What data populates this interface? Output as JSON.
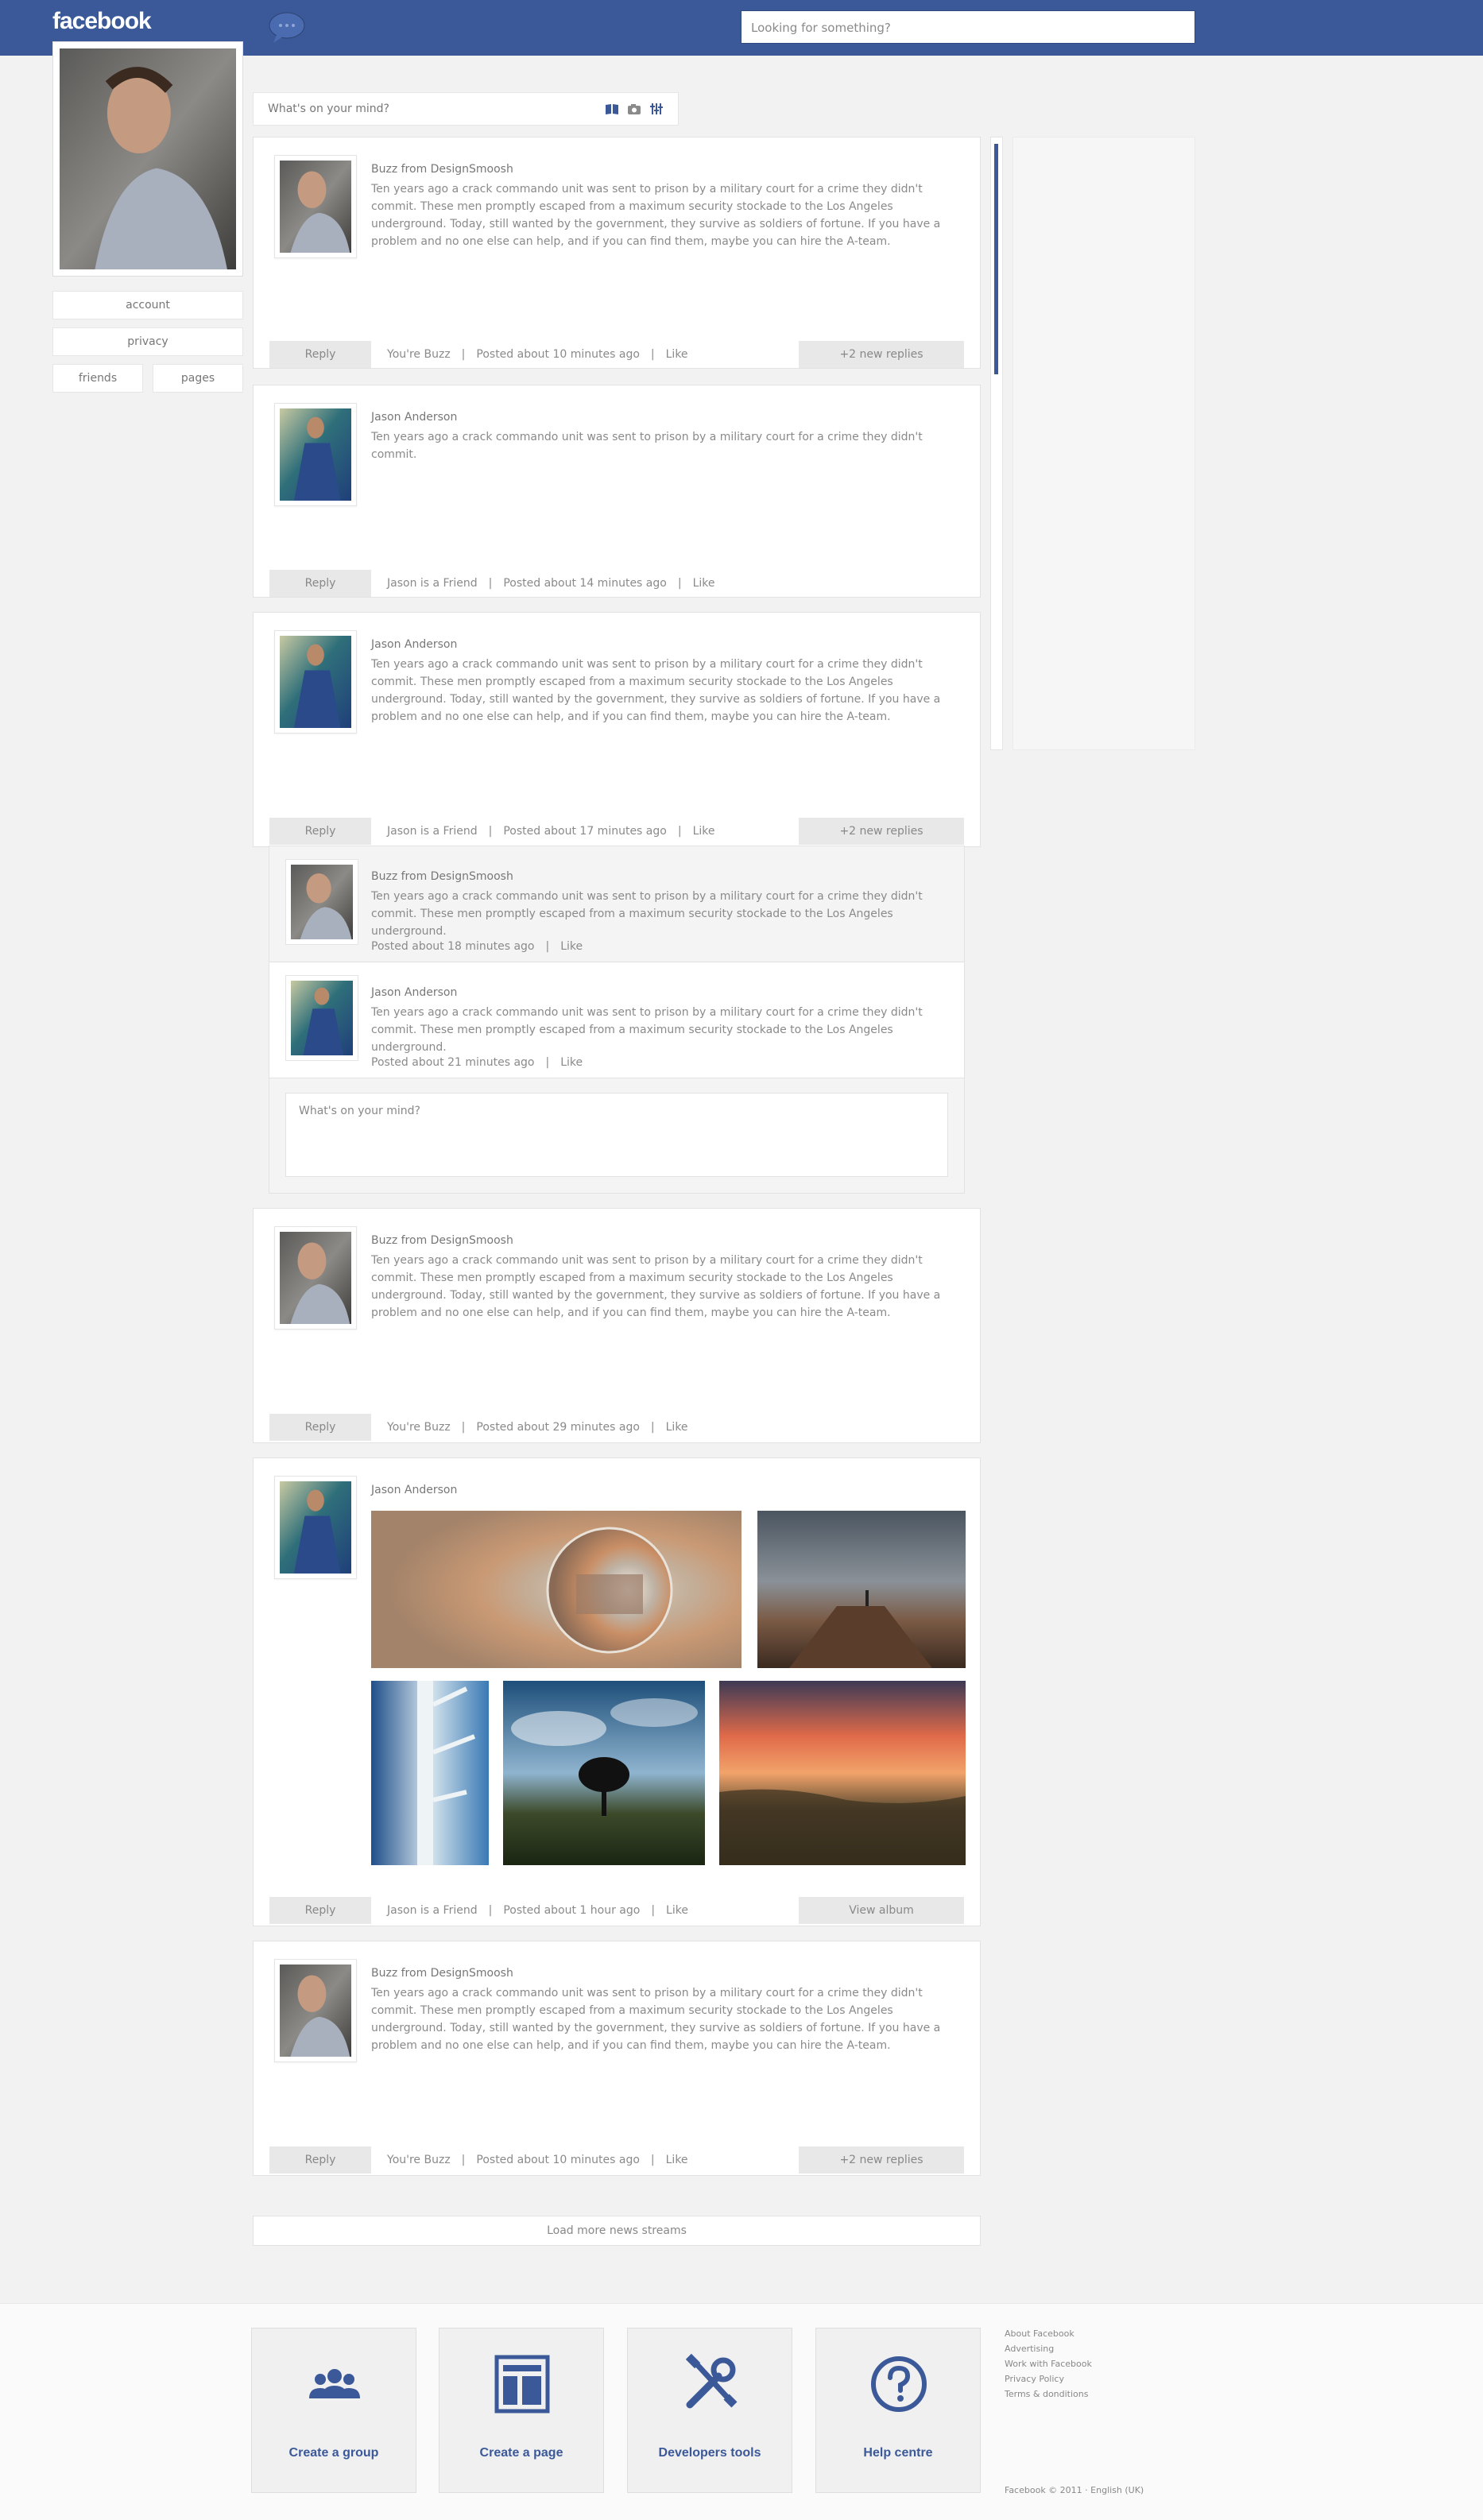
{
  "header": {
    "logo": "facebook",
    "search_placeholder": "Looking for something?"
  },
  "sidebar": {
    "items": [
      {
        "label": "account"
      },
      {
        "label": "privacy"
      },
      {
        "label": "friends"
      },
      {
        "label": "pages"
      }
    ]
  },
  "composer": {
    "placeholder": "What's on your mind?",
    "icons": [
      "book-icon",
      "camera-icon",
      "sliders-icon"
    ]
  },
  "posts": [
    {
      "author": "Buzz from DesignSmoosh",
      "text": "Ten years ago a crack commando unit was sent to prison by a military court for a crime they didn't commit. These men promptly escaped from a maximum security stockade to the Los Angeles underground. Today, still wanted by the government, they survive as soldiers of fortune. If you have a problem and no one else can help, and if you can find them, maybe you can hire the A-team.",
      "reply": "Reply",
      "relation": "You're Buzz",
      "posted": "Posted about 10 minutes ago",
      "like": "Like",
      "action": "+2 new replies"
    },
    {
      "author": "Jason Anderson",
      "text": "Ten years ago a crack commando unit was sent to prison by a military court for a crime they didn't commit.",
      "reply": "Reply",
      "relation": "Jason is a Friend",
      "posted": "Posted about 14 minutes ago",
      "like": "Like"
    },
    {
      "author": "Jason Anderson",
      "text": "Ten years ago a crack commando unit was sent to prison by a military court for a crime they didn't commit. These men promptly escaped from a maximum security stockade to the Los Angeles underground. Today, still wanted by the government, they survive as soldiers of fortune. If you have a problem and no one else can help, and if you can find them, maybe you can hire the A-team.",
      "reply": "Reply",
      "relation": "Jason is a Friend",
      "posted": "Posted about 17 minutes ago",
      "like": "Like",
      "action": "+2 new replies"
    },
    {
      "author": "Buzz from DesignSmoosh",
      "text": "Ten years ago a crack commando unit was sent to prison by a military court for a crime they didn't commit. These men promptly escaped from a maximum security stockade to the Los Angeles underground. Today, still wanted by the government, they survive as soldiers of fortune. If you have a problem and no one else can help, and if you can find them, maybe you can hire the A-team.",
      "reply": "Reply",
      "relation": "You're Buzz",
      "posted": "Posted about 29 minutes ago",
      "like": "Like"
    },
    {
      "author": "Jason Anderson",
      "reply": "Reply",
      "relation": "Jason is a Friend",
      "posted": "Posted about 1 hour ago",
      "like": "Like",
      "action": "View album"
    },
    {
      "author": "Buzz from DesignSmoosh",
      "text": "Ten years ago a crack commando unit was sent to prison by a military court for a crime they didn't commit. These men promptly escaped from a maximum security stockade to the Los Angeles underground. Today, still wanted by the government, they survive as soldiers of fortune. If you have a problem and no one else can help, and if you can find them, maybe you can hire the A-team.",
      "reply": "Reply",
      "relation": "You're Buzz",
      "posted": "Posted about 10 minutes ago",
      "like": "Like",
      "action": "+2 new replies"
    }
  ],
  "replies": [
    {
      "author": "Buzz from DesignSmoosh",
      "text": "Ten years ago a crack commando unit was sent to prison by a military court for a crime they didn't commit. These men promptly escaped from a maximum security stockade to the Los Angeles underground.",
      "posted": "Posted about 18 minutes ago",
      "like": "Like"
    },
    {
      "author": "Jason Anderson",
      "text": "Ten years ago a crack commando unit was sent to prison by a military court for a crime they didn't commit. These men promptly escaped from a maximum security stockade to the Los Angeles underground.",
      "posted": "Posted about 21 minutes ago",
      "like": "Like"
    }
  ],
  "reply_box_placeholder": "What's on your mind?",
  "load_more": "Load more news streams",
  "footer": {
    "tiles": [
      {
        "label": "Create a group",
        "icon": "group-icon"
      },
      {
        "label": "Create a page",
        "icon": "page-layout-icon"
      },
      {
        "label": "Developers tools",
        "icon": "tools-icon"
      },
      {
        "label": "Help centre",
        "icon": "help-icon"
      }
    ],
    "links": [
      "About Facebook",
      "Advertising",
      "Work with Facebook",
      "Privacy Policy",
      "Terms & donditions"
    ],
    "copyright": "Facebook © 2011 · English (UK)"
  },
  "colors": {
    "brand": "#3b5998",
    "background": "#f2f2f2"
  }
}
